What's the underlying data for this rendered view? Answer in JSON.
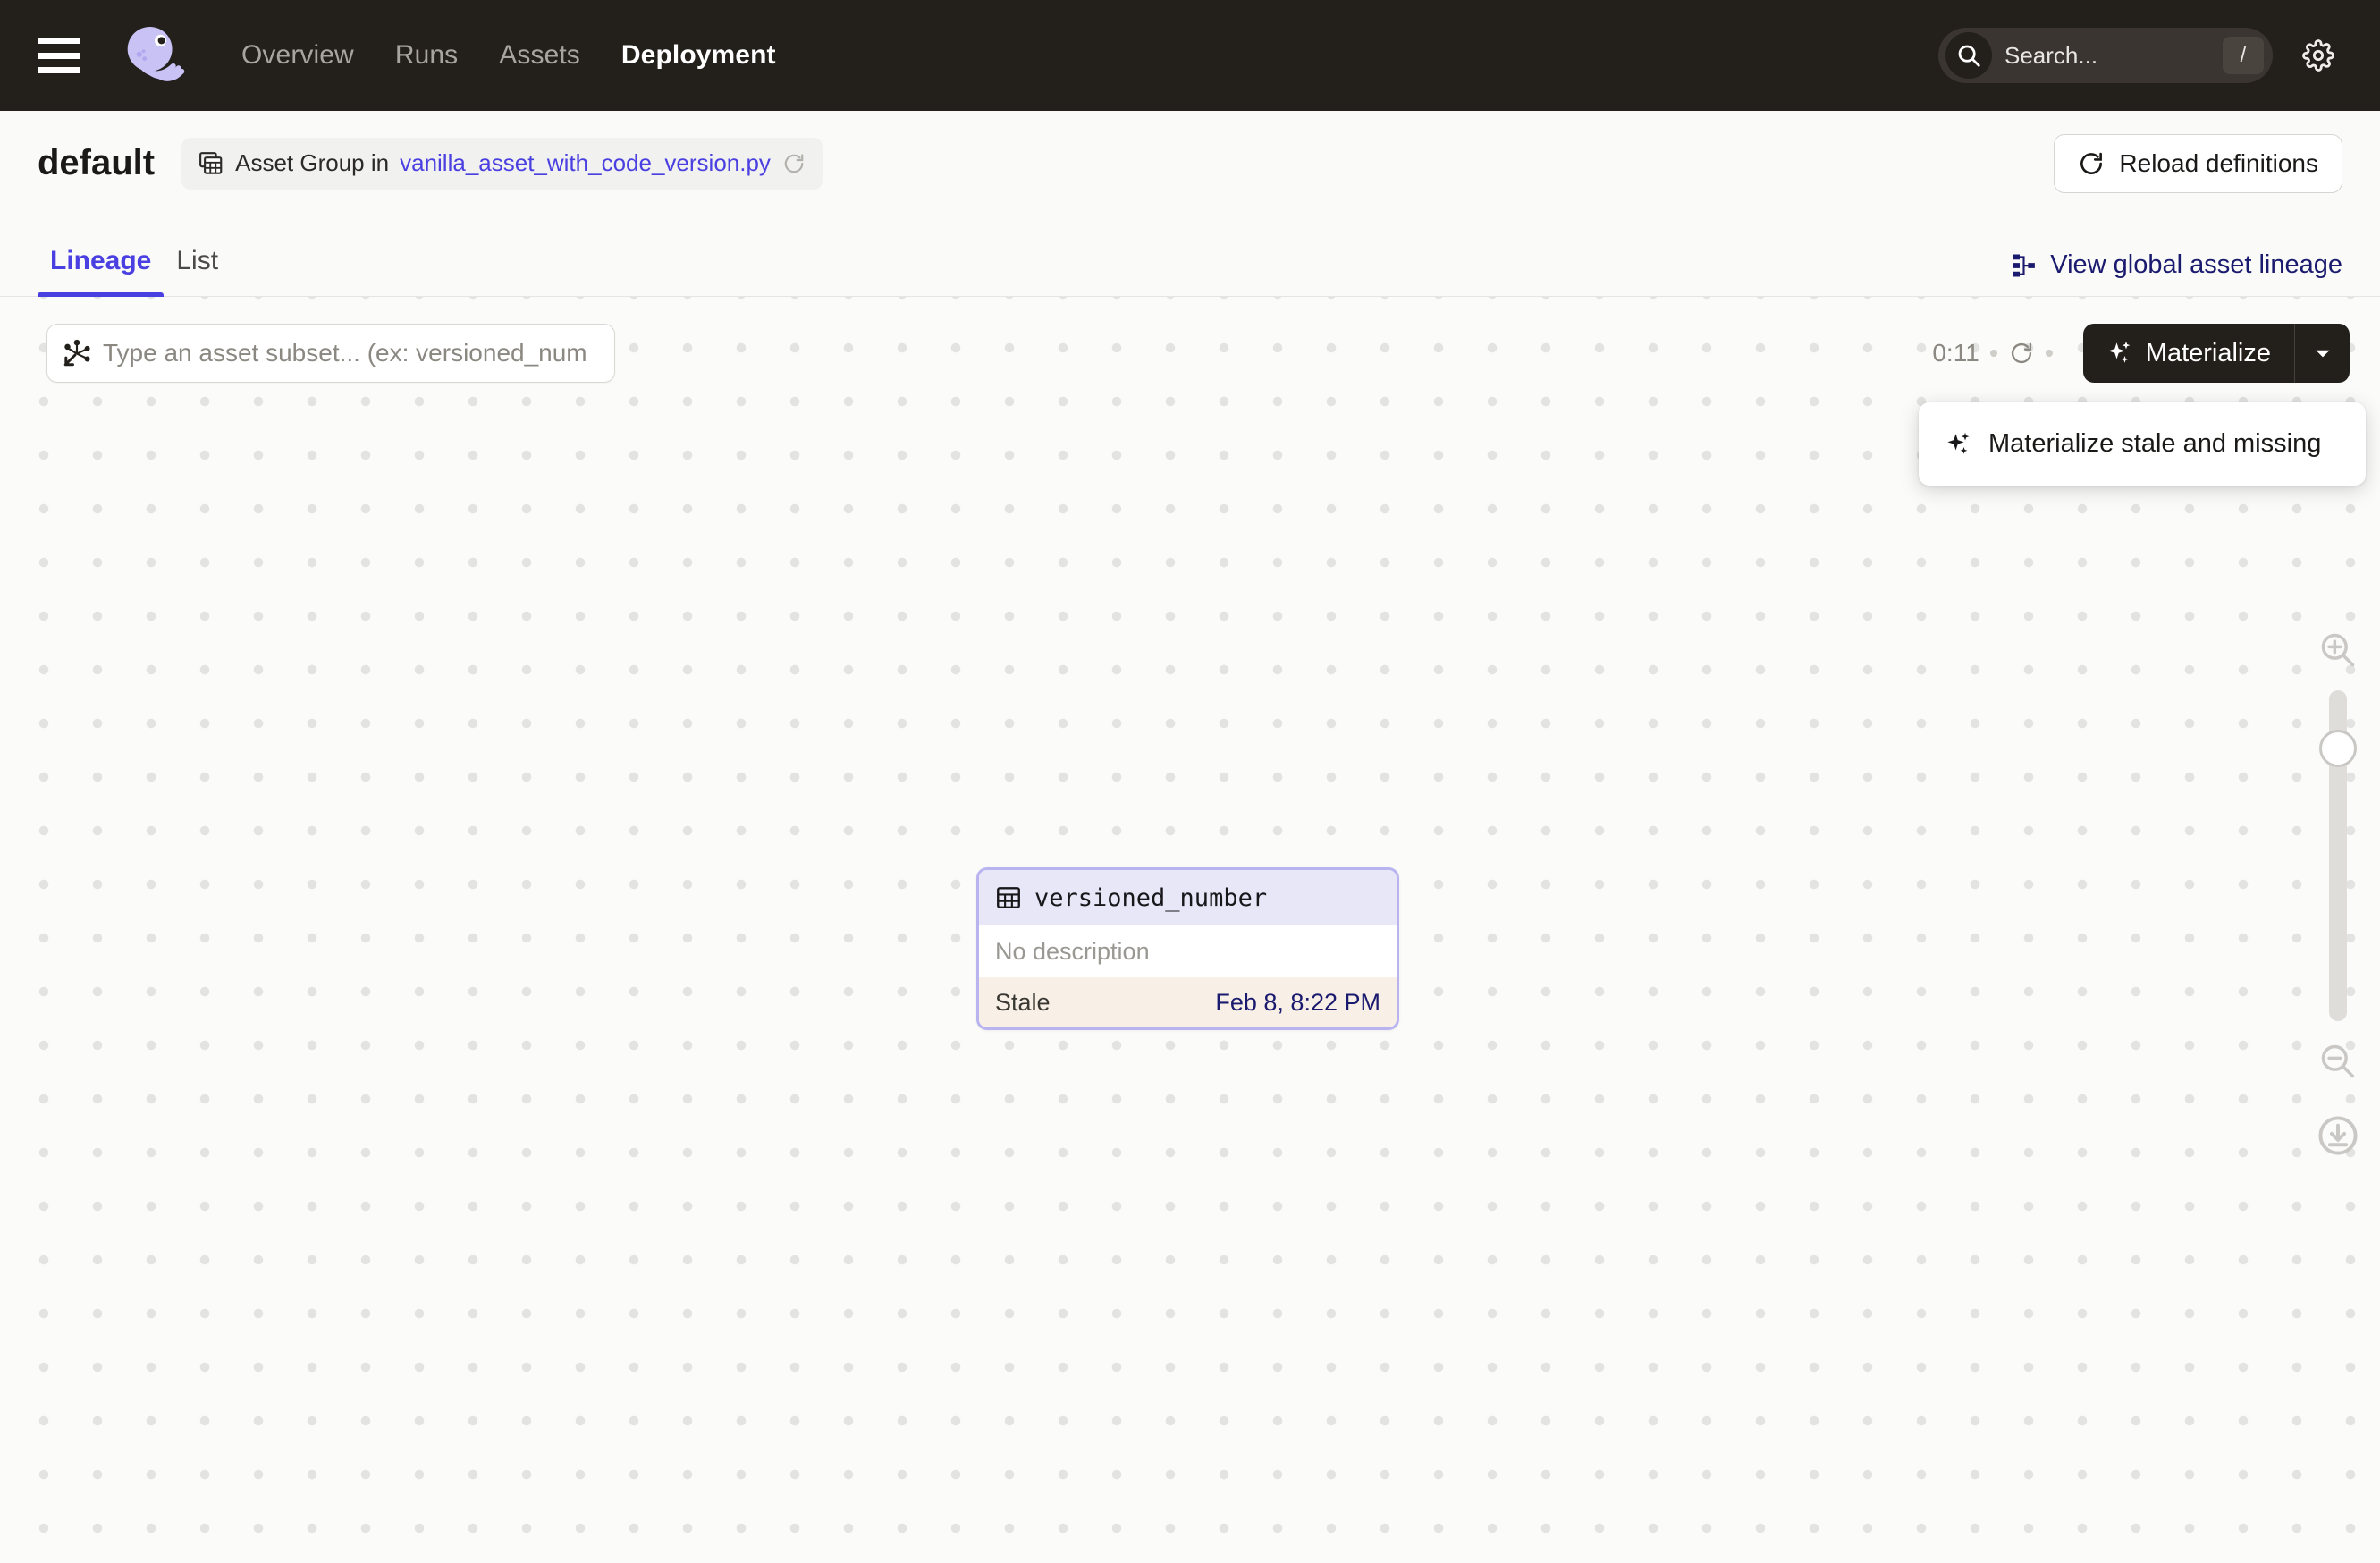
{
  "topnav": {
    "menu_icon": "hamburger-icon",
    "logo_icon": "dagster-logo",
    "links": [
      {
        "label": "Overview",
        "active": false
      },
      {
        "label": "Runs",
        "active": false
      },
      {
        "label": "Assets",
        "active": false
      },
      {
        "label": "Deployment",
        "active": true
      }
    ],
    "search": {
      "icon": "search-icon",
      "placeholder": "Search...",
      "shortcut": "/"
    },
    "settings_icon": "gear-icon",
    "background": "#231F1B"
  },
  "header": {
    "title": "default",
    "group_icon": "asset-group-icon",
    "group_label": "Asset Group in",
    "group_file": "vanilla_asset_with_code_version.py",
    "group_refresh_icon": "refresh-icon",
    "reload_button": {
      "label": "Reload definitions",
      "icon": "refresh-icon"
    }
  },
  "tabs": {
    "items": [
      {
        "label": "Lineage",
        "active": true
      },
      {
        "label": "List",
        "active": false
      }
    ],
    "global_lineage": {
      "label": "View global asset lineage",
      "icon": "lineage-graph-icon"
    },
    "accent": "#4A3FE0"
  },
  "toolbar": {
    "subset_input": {
      "icon": "asset-selection-icon",
      "placeholder": "Type an asset subset... (ex: versioned_num",
      "value": ""
    },
    "timer": "0:11",
    "timer_refresh_icon": "refresh-icon",
    "materialize": {
      "label": "Materialize",
      "icon": "sparkle-icon",
      "caret_icon": "chevron-down-icon"
    },
    "menu": {
      "items": [
        {
          "label": "Materialize stale and missing",
          "icon": "sparkle-icon"
        }
      ]
    }
  },
  "graph": {
    "nodes": [
      {
        "name": "versioned_number",
        "icon": "table-icon",
        "description": "No description",
        "status": "Stale",
        "timestamp": "Feb 8, 8:22 PM",
        "header_color": "#E8E7F8",
        "border_color": "#B9B4F0",
        "footer_color": "#F8EFE6",
        "timestamp_color": "#1A1A6E"
      }
    ],
    "zoom_controls": {
      "zoom_in_icon": "zoom-in-icon",
      "zoom_out_icon": "zoom-out-icon",
      "fit_icon": "zoom-to-fit-icon"
    }
  }
}
